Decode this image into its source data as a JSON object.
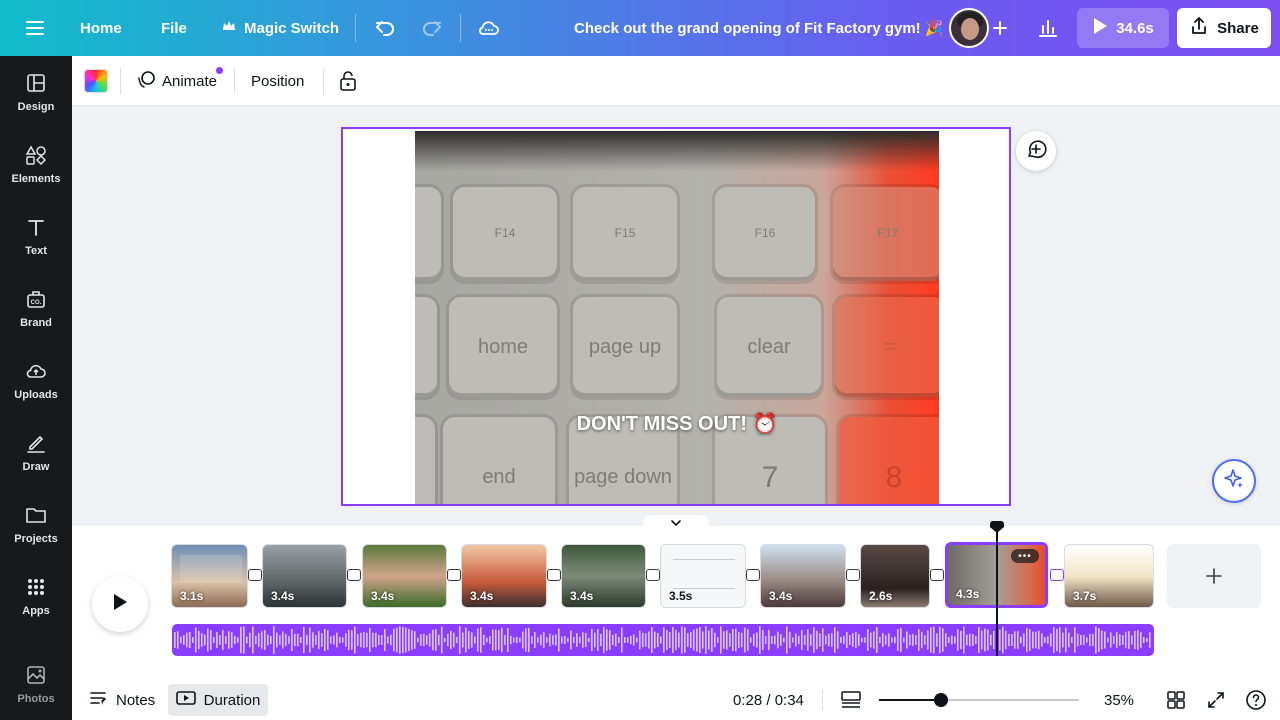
{
  "topbar": {
    "home": "Home",
    "file": "File",
    "magic_switch": "Magic Switch",
    "title": "Check out the grand opening of Fit Factory gym! 🎉",
    "play_duration": "34.6s",
    "share": "Share"
  },
  "sidebar": {
    "items": [
      {
        "label": "Design",
        "icon": "design-icon"
      },
      {
        "label": "Elements",
        "icon": "elements-icon"
      },
      {
        "label": "Text",
        "icon": "text-icon"
      },
      {
        "label": "Brand",
        "icon": "brand-icon"
      },
      {
        "label": "Uploads",
        "icon": "uploads-icon"
      },
      {
        "label": "Draw",
        "icon": "draw-icon"
      },
      {
        "label": "Projects",
        "icon": "projects-icon"
      },
      {
        "label": "Apps",
        "icon": "apps-icon"
      },
      {
        "label": "Photos",
        "icon": "photos-icon"
      }
    ]
  },
  "context_toolbar": {
    "animate": "Animate",
    "position": "Position"
  },
  "canvas": {
    "caption": "DON'T MISS OUT! ⏰",
    "keys": {
      "f14": "F14",
      "f15": "F15",
      "f16": "F16",
      "f17": "F17",
      "home": "home",
      "page_up": "page up",
      "clear": "clear",
      "equals": "=",
      "end": "end",
      "page_down": "page down",
      "seven": "7",
      "eight": "8"
    }
  },
  "timeline": {
    "clips": [
      {
        "duration": "3.1s"
      },
      {
        "duration": "3.4s"
      },
      {
        "duration": "3.4s"
      },
      {
        "duration": "3.4s"
      },
      {
        "duration": "3.4s"
      },
      {
        "duration": "3.5s"
      },
      {
        "duration": "3.4s"
      },
      {
        "duration": "2.6s"
      },
      {
        "duration": "4.3s"
      },
      {
        "duration": "3.7s"
      }
    ],
    "selected_clip_index": 8
  },
  "bottombar": {
    "notes": "Notes",
    "duration": "Duration",
    "time": "0:28 / 0:34",
    "zoom": "35%",
    "zoom_fraction": 0.31
  },
  "colors": {
    "accent": "#8b3dff",
    "sidebar_bg": "#18191b"
  }
}
